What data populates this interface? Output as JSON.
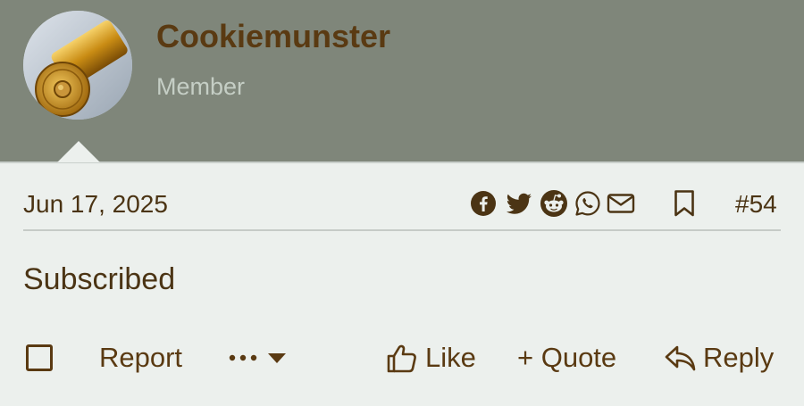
{
  "author": {
    "name": "Cookiemunster",
    "role": "Member",
    "avatar_icon": "brass-cartridge-avatar"
  },
  "post": {
    "date": "Jun 17, 2025",
    "number": "#54",
    "body": "Subscribed"
  },
  "share_icons": [
    "facebook-icon",
    "twitter-icon",
    "reddit-icon",
    "whatsapp-icon",
    "email-icon"
  ],
  "actions": {
    "report": "Report",
    "more": "•••",
    "like": "Like",
    "quote": "+ Quote",
    "reply": "Reply"
  },
  "colors": {
    "header_bg": "#7f867a",
    "page_bg": "#ecf0ed",
    "text_brown": "#4b3414",
    "role_text": "#c5cec5"
  }
}
